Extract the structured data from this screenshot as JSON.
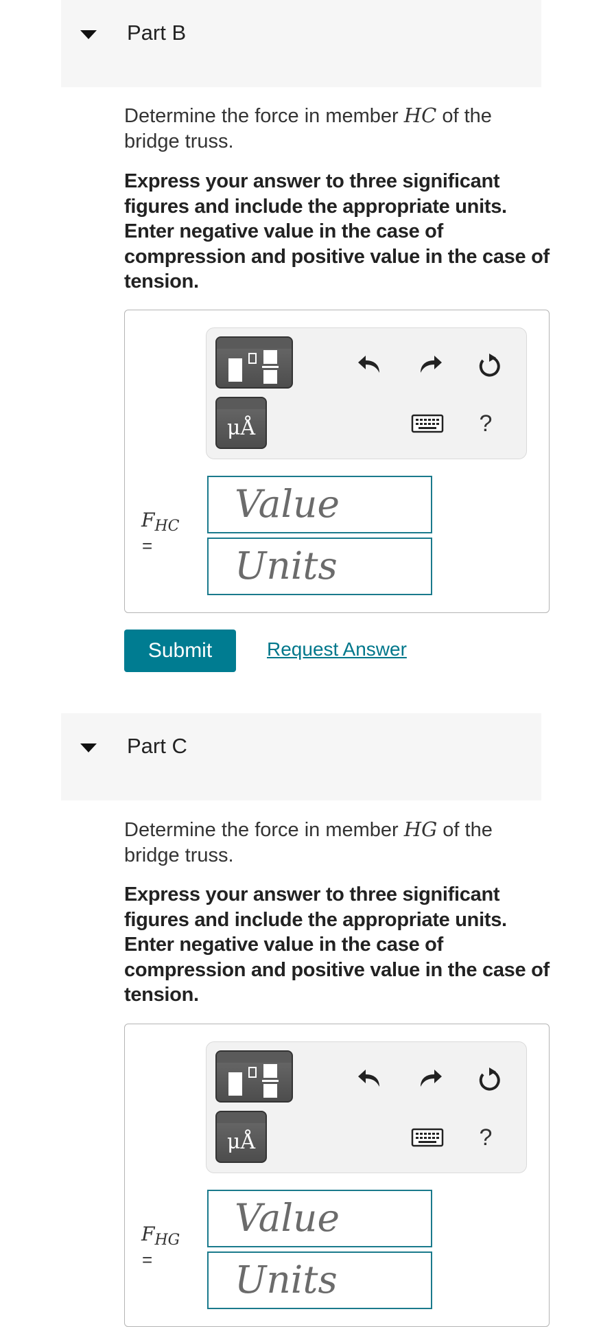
{
  "parts": [
    {
      "title": "Part B",
      "prompt_before": "Determine the force in member ",
      "member": "HC",
      "prompt_after": " of the bridge truss.",
      "instructions": "Express your answer to three significant figures and include the appropriate units. Enter negative value in the case of compression and positive value in the case of tension.",
      "label_var": "F",
      "label_sub": "HC",
      "equals": "=",
      "value_placeholder": "Value",
      "units_placeholder": "Units",
      "submit_label": "Submit",
      "request_label": "Request Answer"
    },
    {
      "title": "Part C",
      "prompt_before": "Determine the force in member ",
      "member": "HG",
      "prompt_after": " of the bridge truss.",
      "instructions": "Express your answer to three significant figures and include the appropriate units. Enter negative value in the case of compression and positive value in the case of tension.",
      "label_var": "F",
      "label_sub": "HG",
      "equals": "=",
      "value_placeholder": "Value",
      "units_placeholder": "Units"
    }
  ],
  "toolbar": {
    "units_glyph": "μÅ",
    "help": "?",
    "icons": [
      "templates-icon",
      "units-icon",
      "undo-icon",
      "redo-icon",
      "reset-icon",
      "keyboard-icon",
      "help-icon"
    ]
  },
  "colors": {
    "accent": "#007c91",
    "field_border": "#1a7a8c",
    "header_bg": "#f6f6f6"
  }
}
